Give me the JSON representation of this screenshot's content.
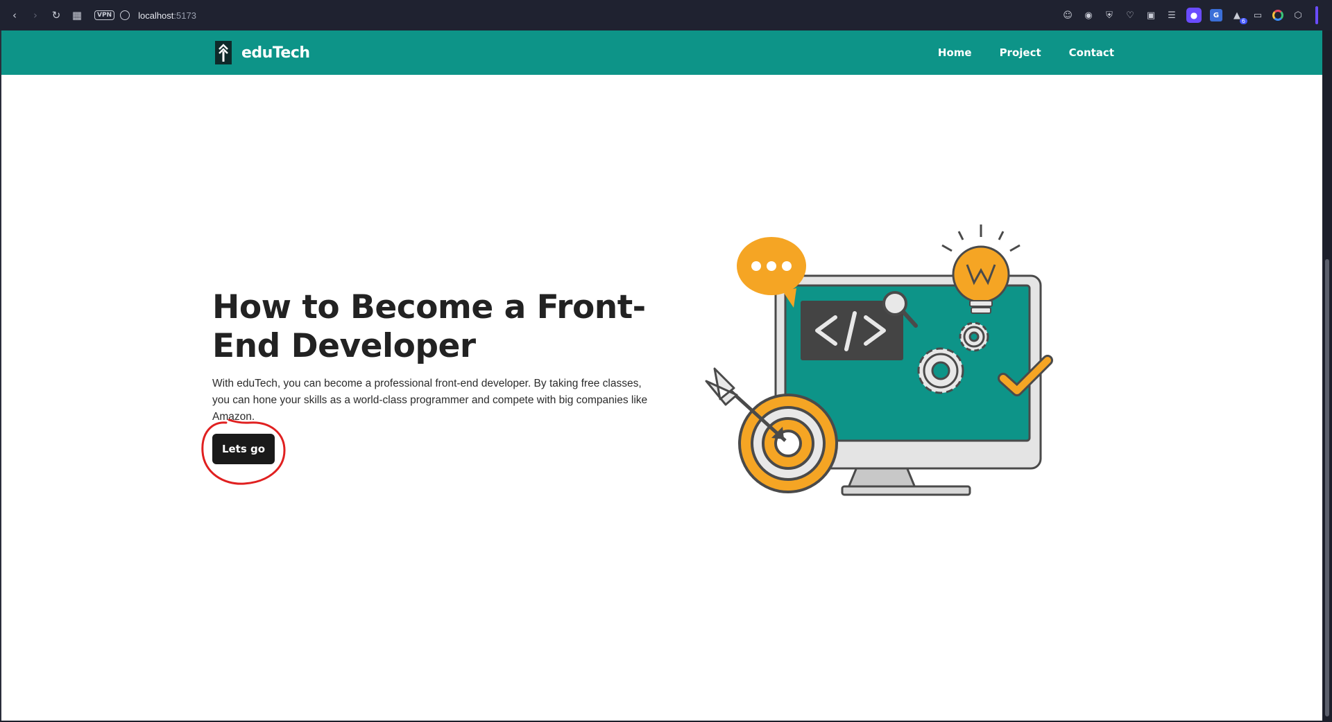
{
  "browser": {
    "vpn_label": "VPN",
    "url_host": "localhost",
    "url_port": ":5173",
    "extension_badge": "6"
  },
  "site": {
    "brand": "eduTech",
    "nav": [
      {
        "label": "Home"
      },
      {
        "label": "Project"
      },
      {
        "label": "Contact"
      }
    ]
  },
  "hero": {
    "title_line1": "How to Become a Front-",
    "title_line2": "End Developer",
    "description": "With eduTech, you can become a professional front-end developer. By taking free classes, you can hone your skills as a world-class programmer and compete with big companies like Amazon.",
    "cta_label": "Lets go"
  },
  "colors": {
    "header_bg": "#0d9488",
    "cta_bg": "#1a1a1a",
    "illustration_accent": "#f5a524",
    "annotation": "#e02020"
  },
  "icons": [
    "back-icon",
    "forward-icon",
    "reload-icon",
    "tabs-grid-icon",
    "globe-icon",
    "emoji-icon",
    "camera-icon",
    "shield-icon",
    "heart-icon",
    "wallet-icon",
    "menu-icon",
    "profile-icon",
    "translate-icon",
    "extension-icon",
    "file-icon",
    "ring-icon",
    "cube-icon"
  ]
}
